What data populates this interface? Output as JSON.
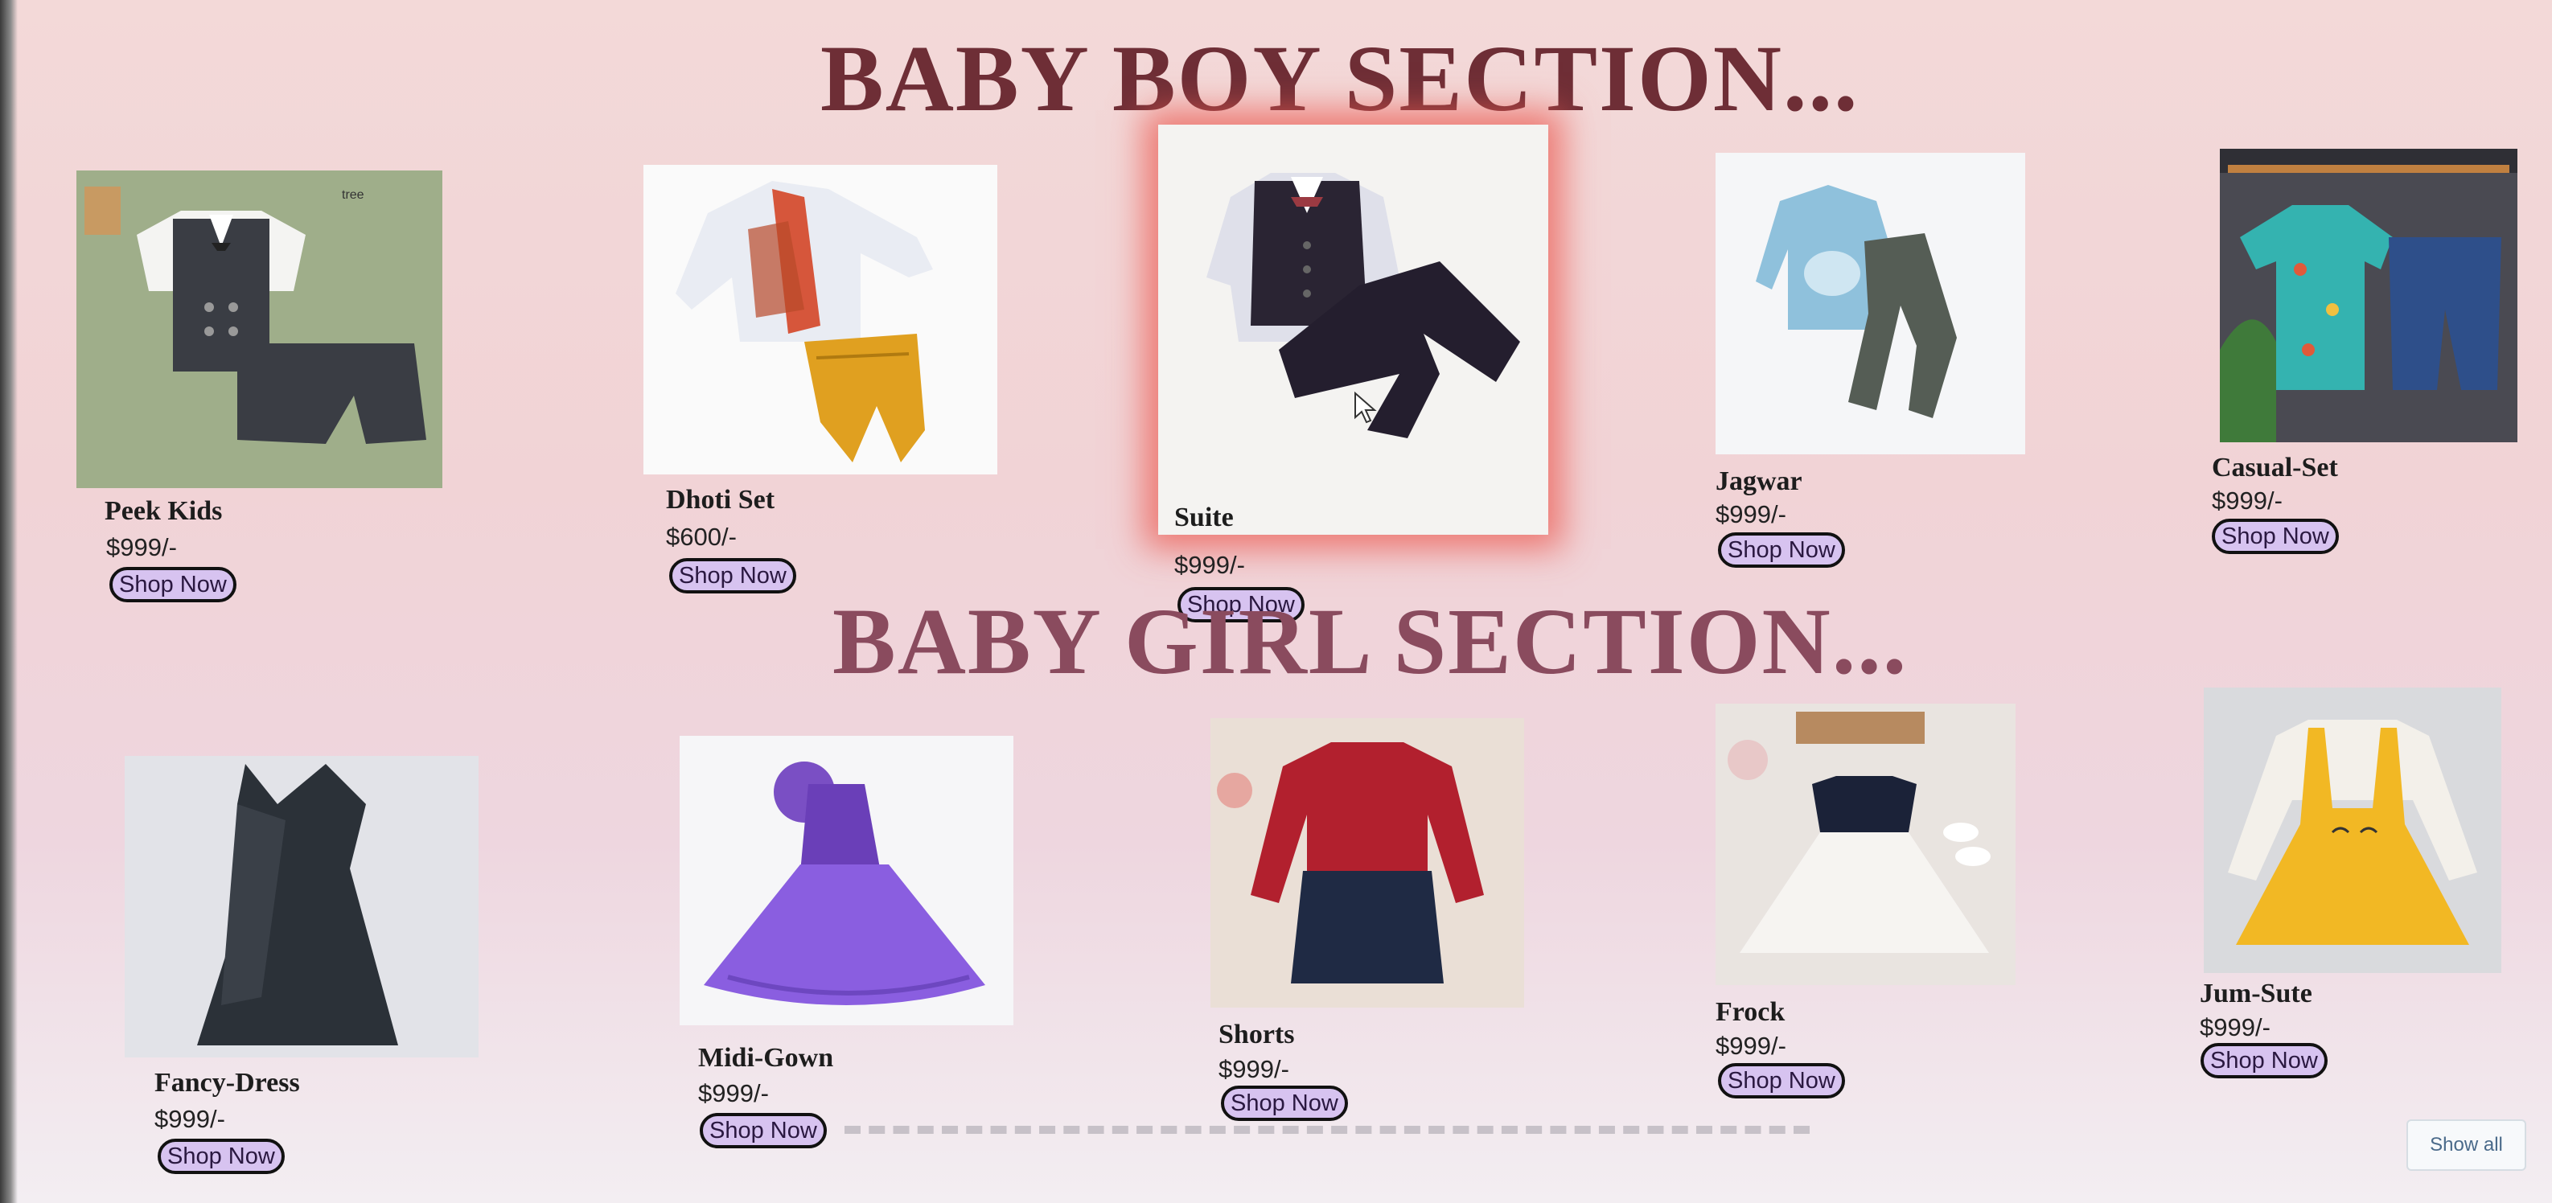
{
  "boy_section": {
    "title": "BABY BOY SECTION...",
    "products": [
      {
        "name": "Peek Kids",
        "price": "$999/-",
        "button": "Shop Now"
      },
      {
        "name": "Dhoti Set",
        "price": "$600/-",
        "button": "Shop Now"
      },
      {
        "name": "Suite",
        "price": "$999/-",
        "button": "Shop Now"
      },
      {
        "name": "Jagwar",
        "price": "$999/-",
        "button": "Shop Now"
      },
      {
        "name": "Casual-Set",
        "price": "$999/-",
        "button": "Shop Now"
      }
    ]
  },
  "girl_section": {
    "title": "BABY GIRL SECTION...",
    "products": [
      {
        "name": "Fancy-Dress",
        "price": "$999/-",
        "button": "Shop Now"
      },
      {
        "name": "Midi-Gown",
        "price": "$999/-",
        "button": "Shop Now"
      },
      {
        "name": "Shorts",
        "price": "$999/-",
        "button": "Shop Now"
      },
      {
        "name": "Frock",
        "price": "$999/-",
        "button": "Shop Now"
      },
      {
        "name": "Jum-Sute",
        "price": "$999/-",
        "button": "Shop Now"
      }
    ]
  },
  "footer": {
    "show_all": "Show all"
  },
  "colors": {
    "boy_title": "#6e2e36",
    "girl_title": "#8a4b5e",
    "button_bg": "#d7c3f0",
    "hover_glow": "#eb5a50"
  },
  "icons": [
    "mouse-cursor-icon"
  ]
}
